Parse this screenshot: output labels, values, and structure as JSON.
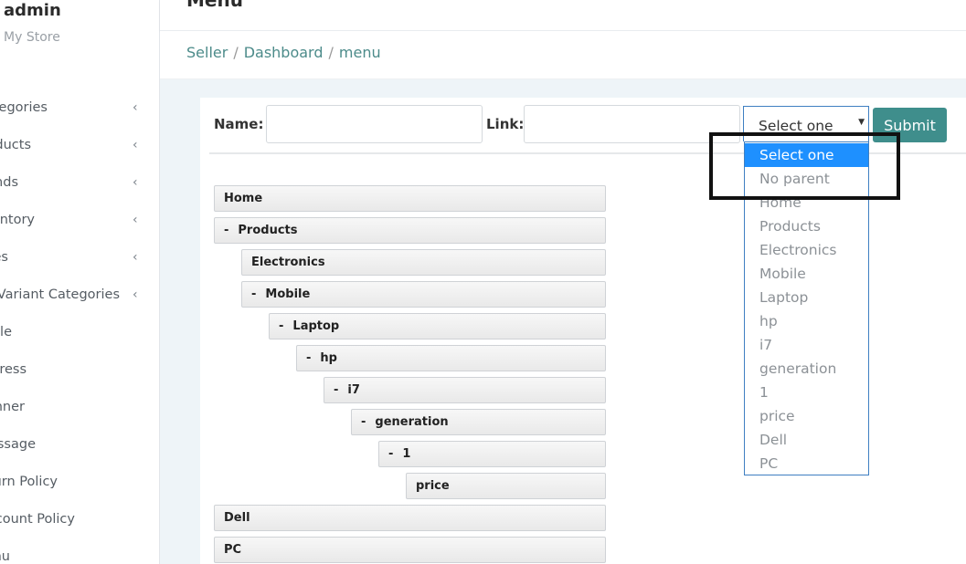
{
  "sidebar": {
    "user_name": "admin",
    "user_store": "My Store",
    "items": [
      {
        "label": "Categories",
        "chevron": "‹"
      },
      {
        "label": "Products",
        "chevron": "‹"
      },
      {
        "label": "Brands",
        "chevron": "‹"
      },
      {
        "label": "Inventory",
        "chevron": "‹"
      },
      {
        "label": "Sizes",
        "chevron": "‹"
      },
      {
        "label": "Variant Categories",
        "chevron": "‹"
      },
      {
        "label": "Role",
        "chevron": ""
      },
      {
        "label": "Address",
        "chevron": ""
      },
      {
        "label": "Banner",
        "chevron": ""
      },
      {
        "label": "Message",
        "chevron": ""
      },
      {
        "label": "Return Policy",
        "chevron": ""
      },
      {
        "label": "Discount Policy",
        "chevron": ""
      },
      {
        "label": "Menu",
        "chevron": ""
      }
    ]
  },
  "header": {
    "title": "Menu"
  },
  "breadcrumb": {
    "items": [
      "Seller",
      "Dashboard",
      "menu"
    ],
    "separator": "/"
  },
  "form": {
    "name_label": "Name:",
    "name_value": "",
    "link_label": "Link:",
    "link_value": "",
    "select_value": "Select one",
    "select_arrow": "▼",
    "submit_label": "Submit"
  },
  "dropdown": {
    "options": [
      "Select one",
      "No parent",
      "Home",
      "Products",
      "Electronics",
      "Mobile",
      "Laptop",
      "hp",
      "i7",
      "generation",
      "1",
      "price",
      "Dell",
      "PC"
    ],
    "selected_index": 0
  },
  "tree": [
    {
      "label": "Home",
      "toggle": ""
    },
    {
      "label": "Products",
      "toggle": "-"
    },
    {
      "label": "Electronics",
      "toggle": ""
    },
    {
      "label": "Mobile",
      "toggle": "-"
    },
    {
      "label": "Laptop",
      "toggle": "-"
    },
    {
      "label": "hp",
      "toggle": "-"
    },
    {
      "label": "i7",
      "toggle": "-"
    },
    {
      "label": "generation",
      "toggle": "-"
    },
    {
      "label": "1",
      "toggle": "-"
    },
    {
      "label": "price",
      "toggle": ""
    },
    {
      "label": "Dell",
      "toggle": ""
    },
    {
      "label": "PC",
      "toggle": ""
    }
  ],
  "colors": {
    "accent": "#3f8e8c",
    "highlight": "#1e90ff",
    "breadcrumb": "#4c8b8a"
  }
}
